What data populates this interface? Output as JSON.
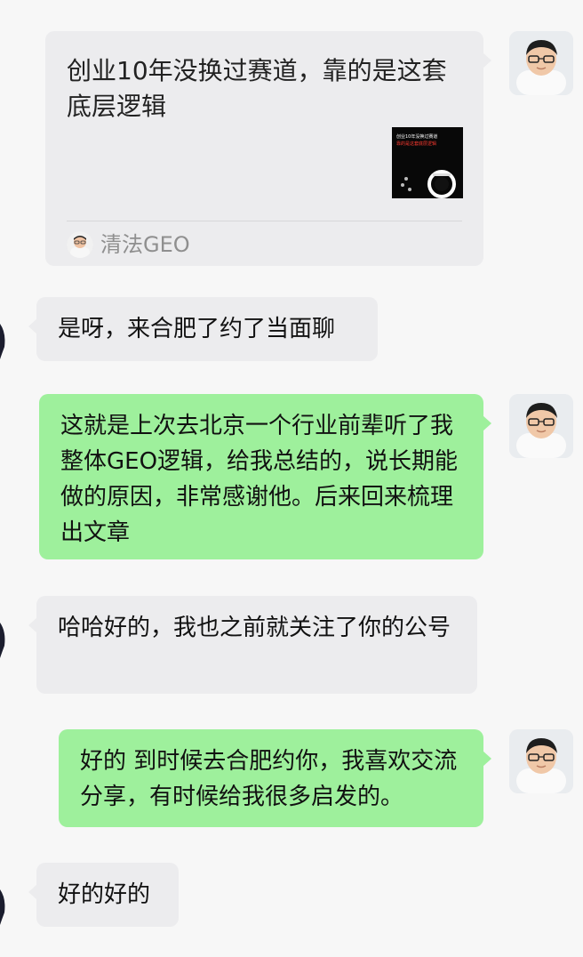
{
  "card": {
    "title": "创业10年没换过赛道，靠的是这套底层逻辑",
    "thumbnail_text": {
      "line1": "创业10年没换过赛道",
      "line2": "靠的是这套底层逻辑"
    },
    "source_name": "清法GEO"
  },
  "messages": [
    {
      "side": "left",
      "text": "是呀，来合肥了约了当面聊"
    },
    {
      "side": "right",
      "text": "这就是上次去北京一个行业前辈听了我整体GEO逻辑，给我总结的，说长期能做的原因，非常感谢他。后来回来梳理出文章"
    },
    {
      "side": "left",
      "text": "哈哈好的，我也之前就关注了你的公号"
    },
    {
      "side": "right",
      "text": "好的 到时候去合肥约你，我喜欢交流分享，有时候给我很多启发的。"
    },
    {
      "side": "left",
      "text": "好的好的"
    }
  ],
  "colors": {
    "background": "#f7f7f7",
    "green_bubble": "#9ef09c",
    "gray_bubble": "#ececee"
  }
}
